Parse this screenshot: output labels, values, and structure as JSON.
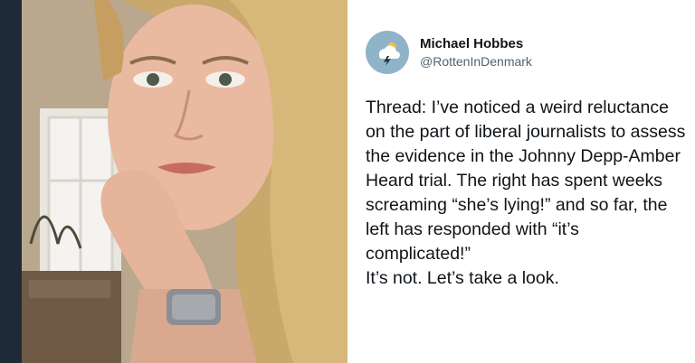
{
  "tweet": {
    "author_name": "Michael Hobbes",
    "author_handle": "@RottenInDenmark",
    "avatar_icon": "storm-cloud-icon",
    "text_line1": "Thread: I’ve noticed a weird reluctance on the part of liberal journalists to assess the evidence in the Johnny Depp-Amber Heard trial. The right has spent weeks screaming “she’s lying!” and so far, the left has responded with “it’s complicated!”",
    "text_line2": "It’s not. Let’s take a look."
  },
  "colors": {
    "stripe": "#1f2a38",
    "text": "#0f1419",
    "handle": "#536471",
    "avatar_bg": "#8fb3c9"
  }
}
